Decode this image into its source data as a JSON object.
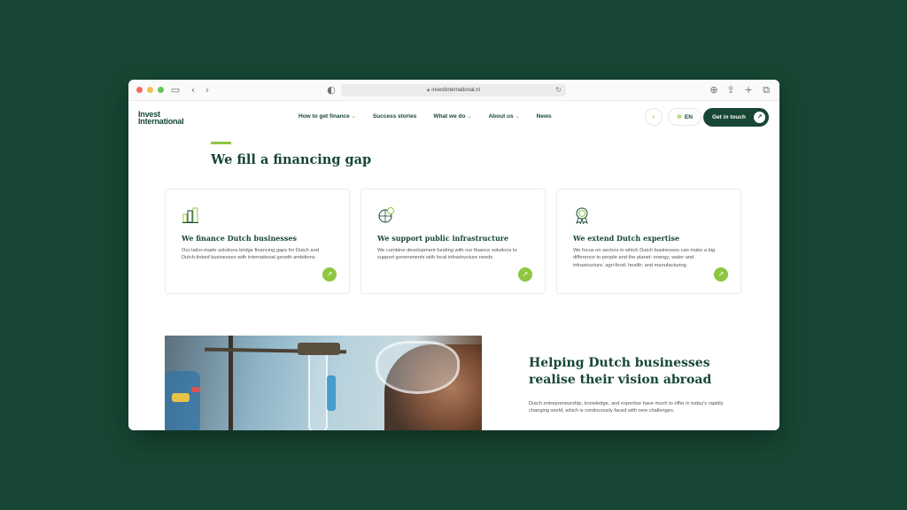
{
  "browser": {
    "url": "investinternational.nl"
  },
  "header": {
    "logo_line1": "Invest",
    "logo_line2": "International",
    "nav": [
      {
        "label": "How to get finance",
        "has_dropdown": true
      },
      {
        "label": "Success stories",
        "has_dropdown": false
      },
      {
        "label": "What we do",
        "has_dropdown": true
      },
      {
        "label": "About us",
        "has_dropdown": true
      },
      {
        "label": "News",
        "has_dropdown": false
      }
    ],
    "language": "EN",
    "cta_label": "Get in touch"
  },
  "section_financing": {
    "title": "We fill a financing gap",
    "cards": [
      {
        "icon": "buildings-icon",
        "title": "We finance Dutch businesses",
        "text": "Our tailor-made solutions bridge financing gaps for Dutch and Dutch-linked businesses with international growth ambitions."
      },
      {
        "icon": "infrastructure-globe-icon",
        "title": "We support public infrastructure",
        "text": "We combine development funding with our finance solutions to support governments with local infrastructure needs."
      },
      {
        "icon": "award-icon",
        "title": "We extend Dutch expertise",
        "text": "We focus on sectors in which Dutch businesses can make a big difference to people and the planet: energy; water and infrastructure; agri-food; health; and manufacturing."
      }
    ]
  },
  "section_helping": {
    "title": "Helping Dutch businesses realise their vision abroad",
    "text": "Dutch entrepreneurship, knowledge, and expertise have much to offer in today's rapidly changing world, which is continuously faced with new challenges."
  },
  "colors": {
    "brand_dark": "#174734",
    "accent_green": "#8ec63f"
  }
}
